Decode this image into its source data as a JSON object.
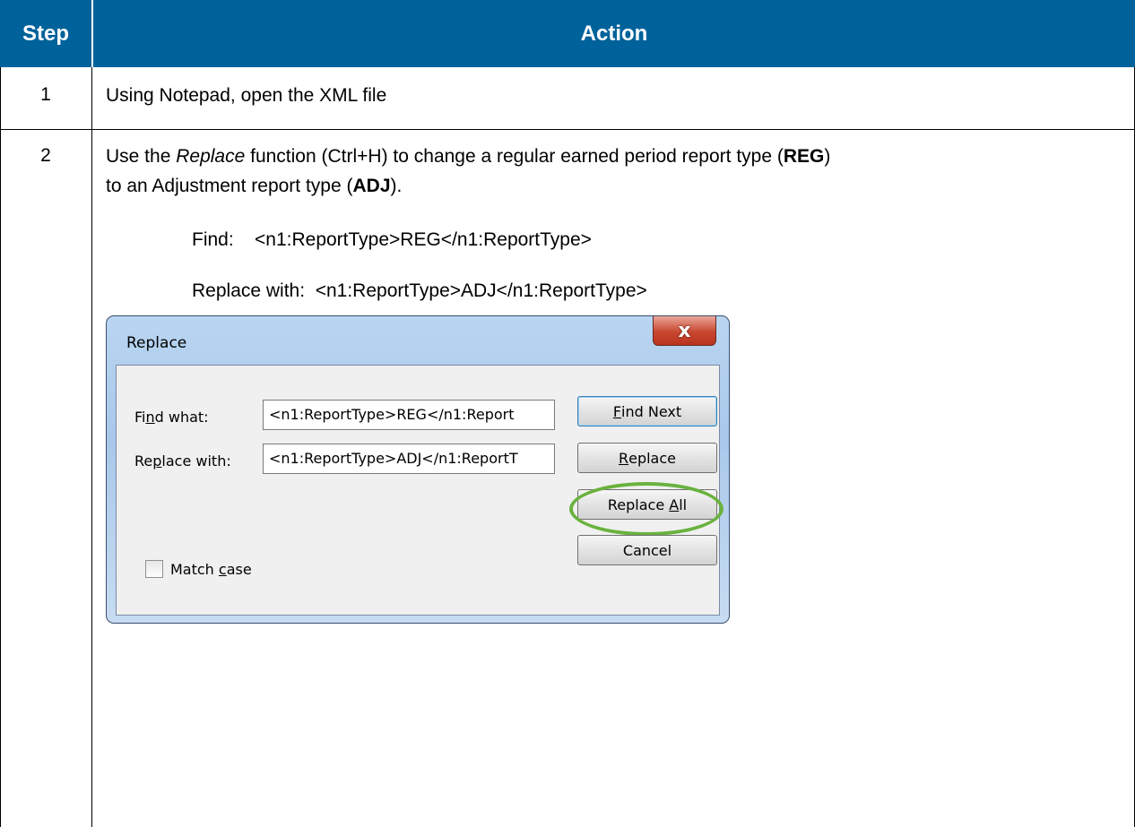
{
  "table": {
    "headers": {
      "step": "Step",
      "action": "Action"
    },
    "rows": [
      {
        "step": "1",
        "text": "Using Notepad, open the XML file"
      },
      {
        "step": "2",
        "line1_a": "Use the ",
        "line1_em": "Replace",
        "line1_b": " function (Ctrl+H) to change a regular earned period report type (",
        "line1_bold": "REG",
        "line1_c": ")",
        "line2_a": "to an Adjustment report type (",
        "line2_bold": "ADJ",
        "line2_b": ").",
        "find_line": "Find:    <n1:ReportType>REG</n1:ReportType>",
        "replace_line": "Replace with:  <n1:ReportType>ADJ</n1:ReportType>"
      }
    ]
  },
  "dialog": {
    "title": "Replace",
    "close_glyph": "x",
    "find_label_pre": "Fi",
    "find_label_u": "n",
    "find_label_post": "d what:",
    "find_value": "<n1:ReportType>REG</n1:Report",
    "replace_label_pre": "Re",
    "replace_label_u": "p",
    "replace_label_post": "lace with:",
    "replace_value": "<n1:ReportType>ADJ</n1:ReportT",
    "buttons": {
      "find_next_u": "F",
      "find_next_rest": "ind Next",
      "replace_u": "R",
      "replace_rest": "eplace",
      "replace_all_pre": "Replace ",
      "replace_all_u": "A",
      "replace_all_rest": "ll",
      "cancel": "Cancel"
    },
    "match_case_pre": "Match ",
    "match_case_u": "c",
    "match_case_rest": "ase",
    "highlight_color": "#6ab23e"
  },
  "colors": {
    "header_bg": "#00629b",
    "header_text": "#ffffff"
  }
}
